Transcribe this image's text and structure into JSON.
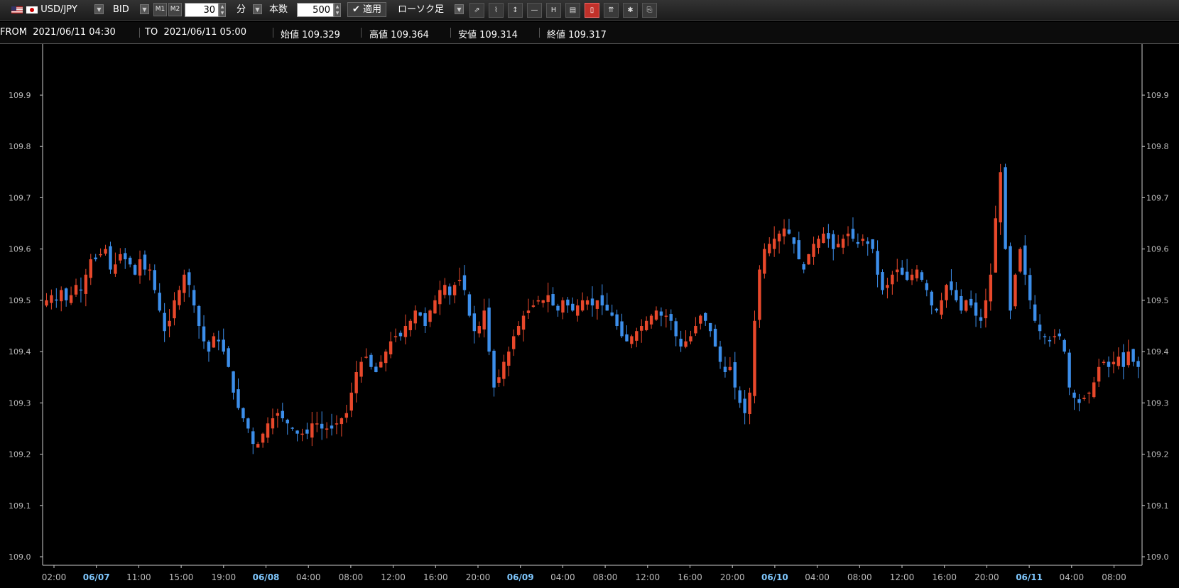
{
  "toolbar": {
    "pair": "USD/JPY",
    "price_type": "BID",
    "m1_label": "M1",
    "m2_label": "M2",
    "interval_value": "30",
    "interval_unit": "分",
    "bars_label": "本数",
    "bars_value": "500",
    "apply_label": "適用",
    "chart_type": "ローソク足",
    "indicator_icons": [
      "trend-icon",
      "pattern-icon",
      "ratio-icon",
      "line-icon",
      "hl-icon",
      "volume-icon",
      "candle-icon",
      "signal-icon",
      "star-icon",
      "export-icon"
    ],
    "active_icon": "candle-icon"
  },
  "info": {
    "from_label": "FROM",
    "from_value": "2021/06/11 04:30",
    "to_label": "TO",
    "to_value": "2021/06/11 05:00",
    "open_label": "始値",
    "open_value": "109.329",
    "high_label": "高値",
    "high_value": "109.364",
    "low_label": "安値",
    "low_value": "109.314",
    "close_label": "終値",
    "close_value": "109.317"
  },
  "colors": {
    "up": "#e8482b",
    "down": "#3c8eea",
    "axis": "#cccccc",
    "date_label": "#7fc8ff"
  },
  "chart_data": {
    "type": "candlestick",
    "y_tick_labels": [
      "109.0",
      "109.1",
      "109.2",
      "109.3",
      "109.4",
      "109.5",
      "109.6",
      "109.7",
      "109.8",
      "109.9"
    ],
    "ylim": [
      109.0,
      109.9
    ],
    "x_tick_labels": [
      "02:00",
      "06/07",
      "11:00",
      "15:00",
      "19:00",
      "06/08",
      "04:00",
      "08:00",
      "12:00",
      "16:00",
      "20:00",
      "06/09",
      "04:00",
      "08:00",
      "12:00",
      "16:00",
      "20:00",
      "06/10",
      "04:00",
      "08:00",
      "12:00",
      "16:00",
      "20:00",
      "06/11",
      "04:00",
      "08:00"
    ],
    "x_tick_is_date": [
      false,
      true,
      false,
      false,
      false,
      true,
      false,
      false,
      false,
      false,
      false,
      true,
      false,
      false,
      false,
      false,
      false,
      true,
      false,
      false,
      false,
      false,
      false,
      true,
      false,
      false
    ],
    "grid": false,
    "series_trend": [
      109.5,
      109.51,
      109.5,
      109.52,
      109.5,
      109.51,
      109.53,
      109.52,
      109.55,
      109.58,
      109.58,
      109.59,
      109.6,
      109.56,
      109.57,
      109.59,
      109.58,
      109.57,
      109.55,
      109.58,
      109.56,
      109.56,
      109.52,
      109.48,
      109.44,
      109.46,
      109.5,
      109.52,
      109.55,
      109.53,
      109.49,
      109.45,
      109.42,
      109.4,
      109.43,
      109.42,
      109.4,
      109.37,
      109.32,
      109.29,
      109.27,
      109.25,
      109.22,
      109.22,
      109.24,
      109.26,
      109.27,
      109.28,
      109.27,
      109.26,
      109.25,
      109.24,
      109.24,
      109.24,
      109.26,
      109.26,
      109.25,
      109.25,
      109.25,
      109.26,
      109.27,
      109.28,
      109.32,
      109.36,
      109.38,
      109.39,
      109.37,
      109.36,
      109.38,
      109.4,
      109.42,
      109.43,
      109.43,
      109.45,
      109.46,
      109.48,
      109.47,
      109.45,
      109.48,
      109.5,
      109.52,
      109.53,
      109.51,
      109.53,
      109.54,
      109.52,
      109.47,
      109.44,
      109.45,
      109.48,
      109.4,
      109.33,
      109.35,
      109.38,
      109.4,
      109.43,
      109.45,
      109.47,
      109.48,
      109.49,
      109.5,
      109.5,
      109.51,
      109.49,
      109.48,
      109.5,
      109.49,
      109.48,
      109.49,
      109.5,
      109.5,
      109.49,
      109.5,
      109.49,
      109.48,
      109.47,
      109.45,
      109.43,
      109.42,
      109.43,
      109.44,
      109.45,
      109.46,
      109.47,
      109.48,
      109.47,
      109.47,
      109.46,
      109.43,
      109.41,
      109.42,
      109.43,
      109.45,
      109.47,
      109.46,
      109.44,
      109.41,
      109.38,
      109.36,
      109.37,
      109.33,
      109.3,
      109.28,
      109.32,
      109.46,
      109.56,
      109.6,
      109.61,
      109.62,
      109.63,
      109.64,
      109.63,
      109.61,
      109.58,
      109.56,
      109.59,
      109.61,
      109.62,
      109.63,
      109.62,
      109.6,
      109.61,
      109.62,
      109.63,
      109.62,
      109.61,
      109.62,
      109.61,
      109.6,
      109.55,
      109.52,
      109.53,
      109.55,
      109.56,
      109.55,
      109.54,
      109.55,
      109.56,
      109.54,
      109.52,
      109.49,
      109.48,
      109.5,
      109.53,
      109.52,
      109.5,
      109.48,
      109.5,
      109.49,
      109.47,
      109.46,
      109.5,
      109.55,
      109.66,
      109.75,
      109.6,
      109.48,
      109.55,
      109.6,
      109.55,
      109.5,
      109.46,
      109.44,
      109.43,
      109.42,
      109.43,
      109.43,
      109.4,
      109.33,
      109.31,
      109.3,
      109.31,
      109.32,
      109.34,
      109.37,
      109.38,
      109.37,
      109.38,
      109.39,
      109.37,
      109.4,
      109.38,
      109.37
    ],
    "last_window": {
      "open": 109.329,
      "high": 109.364,
      "low": 109.314,
      "close": 109.317
    }
  }
}
